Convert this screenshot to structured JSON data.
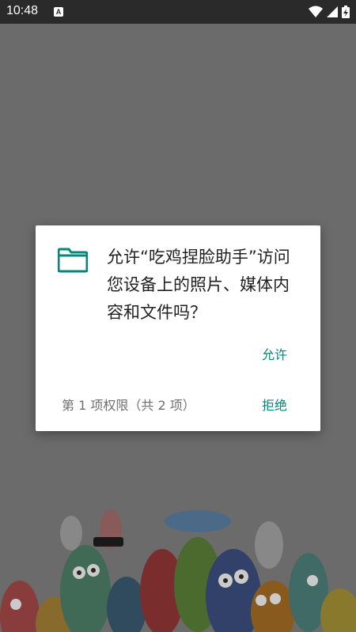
{
  "status_bar": {
    "time": "10:48",
    "notification_icon_label": "A",
    "icons": [
      "wifi-icon",
      "signal-icon",
      "battery-charging-icon"
    ]
  },
  "dialog": {
    "icon": "folder-icon",
    "message": "允许“吃鸡捏脸助手”访问您设备上的照片、媒体内容和文件吗？",
    "allow_label": "允许",
    "counter_text": "第 1 项权限（共 2 项）",
    "deny_label": "拒绝",
    "accent_color": "#00897b"
  }
}
